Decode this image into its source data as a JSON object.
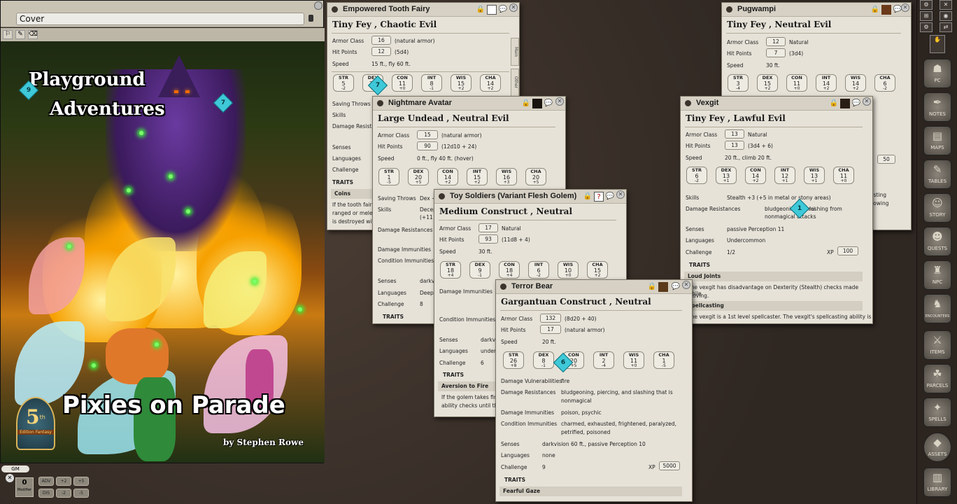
{
  "cover": {
    "title": "Cover",
    "book_title_line1": "Playground",
    "book_title_line2": "Adventures",
    "main_title": "Pixies on Parade",
    "author": "by Stephen Rowe",
    "edition_badge_number": "5",
    "edition_badge_suffix": "th",
    "edition_badge_text": "Edition Fantasy",
    "dice": [
      "9",
      "7"
    ]
  },
  "toolbar_icons": [
    "gear-icon",
    "dice-icon",
    "measure-icon",
    "eye-icon",
    "arrows-icon"
  ],
  "sidebar": [
    {
      "label": "PC",
      "icon": "person-icon"
    },
    {
      "label": "NOTES",
      "icon": "quill-icon"
    },
    {
      "label": "MAPS",
      "icon": "map-icon"
    },
    {
      "label": "TABLES",
      "icon": "table-icon"
    },
    {
      "label": "STORY",
      "icon": "mask-icon"
    },
    {
      "label": "QUESTS",
      "icon": "mask-icon"
    },
    {
      "label": "NPC",
      "icon": "helmet-icon"
    },
    {
      "label": "ENCOUNTERS",
      "icon": "helmet-icon"
    },
    {
      "label": "ITEMS",
      "icon": "sword-icon"
    },
    {
      "label": "PARCELS",
      "icon": "bag-icon"
    },
    {
      "label": "SPELLS",
      "icon": "book-icon"
    },
    {
      "label": "ASSETS",
      "icon": "gem-icon"
    },
    {
      "label": "LIBRARY",
      "icon": "books-icon"
    }
  ],
  "hotbar": {
    "gm_label": "GM",
    "modifier_value": "0",
    "modifier_label": "Modifier",
    "keys": [
      "ADV",
      "+2",
      "+5",
      "DIS",
      "-2",
      "-5"
    ]
  },
  "sheets": {
    "fairy": {
      "name": "Empowered Tooth Fairy",
      "type": "Tiny Fey , Chaotic Evil",
      "ac_label": "Armor Class",
      "ac": "16",
      "ac_note": "(natural armor)",
      "hp_label": "Hit Points",
      "hp": "12",
      "hp_note": "(5d4)",
      "speed_label": "Speed",
      "speed": "15 ft., fly 60 ft.",
      "stats": [
        [
          "STR",
          "5",
          "-2"
        ],
        [
          "DEX",
          "22",
          "+6"
        ],
        [
          "CON",
          "11",
          "+0"
        ],
        [
          "INT",
          "8",
          "-1"
        ],
        [
          "WIS",
          "15",
          "+2"
        ],
        [
          "CHA",
          "14",
          "+2"
        ]
      ],
      "saving_label": "Saving Throws",
      "skills_label": "Skills",
      "dmgres_label": "Damage Resistance",
      "senses_label": "Senses",
      "lang_label": "Languages",
      "challenge_label": "Challenge",
      "traits": "TRAITS",
      "trait1": "Coins",
      "trait1_text_a": "If the tooth fairy",
      "trait1_text_b": "ranged or melee",
      "trait1_text_c": "is destroyed with",
      "side_tab": "Main",
      "side_tab2": "Other"
    },
    "pugwampi": {
      "name": "Pugwampi",
      "type": "Tiny Fey , Neutral Evil",
      "ac_label": "Armor Class",
      "ac": "12",
      "ac_note": "Natural",
      "hp_label": "Hit Points",
      "hp": "7",
      "hp_note": "(3d4)",
      "speed_label": "Speed",
      "speed": "30 ft.",
      "stats": [
        [
          "STR",
          "3",
          "-4"
        ],
        [
          "DEX",
          "15",
          "+2"
        ],
        [
          "CON",
          "11",
          "+0"
        ],
        [
          "INT",
          "14",
          "+2"
        ],
        [
          "WIS",
          "14",
          "+2"
        ],
        [
          "CHA",
          "6",
          "-2"
        ]
      ],
      "xp_label": "XP",
      "xp": "50",
      "text_a": "asting",
      "text_b": "llowing"
    },
    "nightmare": {
      "name": "Nightmare Avatar",
      "type": "Large Undead , Neutral Evil",
      "ac_label": "Armor Class",
      "ac": "15",
      "ac_note": "(natural armor)",
      "hp_label": "Hit Points",
      "hp": "90",
      "hp_note": "(12d10 + 24)",
      "speed_label": "Speed",
      "speed": "0 ft., fly 40 ft. (hover)",
      "stats": [
        [
          "STR",
          "1",
          "-5"
        ],
        [
          "DEX",
          "20",
          "+5"
        ],
        [
          "CON",
          "14",
          "+2"
        ],
        [
          "INT",
          "15",
          "+2"
        ],
        [
          "WIS",
          "16",
          "+3"
        ],
        [
          "CHA",
          "20",
          "+5"
        ]
      ],
      "saving_label": "Saving Throws",
      "saving": "Dex +9",
      "skills_label": "Skills",
      "skills_a": "Decep",
      "skills_b": "(+11 in",
      "dmgres_label": "Damage Resistances",
      "dmgimm_label": "Damage Immunities",
      "condimm_label": "Condition Immunities",
      "senses_label": "Senses",
      "senses": "darkvis",
      "lang_label": "Languages",
      "lang": "Deep S",
      "challenge_label": "Challenge",
      "challenge": "8",
      "traits": "TRAITS"
    },
    "vexgit": {
      "name": "Vexgit",
      "type": "Tiny Fey , Lawful Evil",
      "ac_label": "Armor Class",
      "ac": "13",
      "ac_note": "Natural",
      "hp_label": "Hit Points",
      "hp": "13",
      "hp_note": "(3d4 + 6)",
      "speed_label": "Speed",
      "speed": "20 ft., climb 20 ft.",
      "stats": [
        [
          "STR",
          "6",
          "-2"
        ],
        [
          "DEX",
          "13",
          "+1"
        ],
        [
          "CON",
          "14",
          "+2"
        ],
        [
          "INT",
          "12",
          "+1"
        ],
        [
          "WIS",
          "13",
          "+1"
        ],
        [
          "CHA",
          "11",
          "+0"
        ]
      ],
      "skills_label": "Skills",
      "skills": "Stealth +3 (+5 in metal or stony areas)",
      "dmgres_label": "Damage Resistances",
      "dmgres_a": "bludgeoning, pierci",
      "dmgres_b": "lashing from",
      "dmgres_c": "nonmagical attacks",
      "senses_label": "Senses",
      "senses": "passive Perception 11",
      "lang_label": "Languages",
      "lang": "Undercommon",
      "challenge_label": "Challenge",
      "challenge": "1/2",
      "xp_label": "XP",
      "xp": "100",
      "traits": "TRAITS",
      "trait1": "Loud Joints",
      "trait1_text_a": "The vexgit has disadvantage on Dexterity (Stealth) checks made while",
      "trait1_text_b": "moving.",
      "trait2": "Spellcasting",
      "trait2_text": "The vexgit is a 1st level spellcaster. The vexgit's spellcasting ability is",
      "die": "1"
    },
    "soldiers": {
      "name": "Toy Soldiers (Variant Flesh Golem)",
      "type": "Medium Construct , Neutral",
      "ac_label": "Armor Class",
      "ac": "17",
      "ac_note": "Natural",
      "hp_label": "Hit Points",
      "hp": "93",
      "hp_note": "(11d8 + 4)",
      "speed_label": "Speed",
      "speed": "30 ft.",
      "stats": [
        [
          "STR",
          "18",
          "+4"
        ],
        [
          "DEX",
          "9",
          "-1"
        ],
        [
          "CON",
          "18",
          "+4"
        ],
        [
          "INT",
          "6",
          "-2"
        ],
        [
          "WIS",
          "10",
          "+0"
        ],
        [
          "CHA",
          "15",
          "+2"
        ]
      ],
      "dmgimm_label": "Damage Immunities",
      "condimm_label": "Condition Immunities",
      "senses_label": "Senses",
      "senses": "darkvi",
      "lang_label": "Languages",
      "lang": "unders",
      "challenge_label": "Challenge",
      "challenge": "6",
      "traits": "TRAITS",
      "trait1": "Aversion to Fire",
      "trait1_text_a": "If the golem takes fire d",
      "trait1_text_b": "ability checks until the e"
    },
    "bear": {
      "name": "Terror Bear",
      "type": "Gargantuan Construct , Neutral",
      "ac_label": "Armor Class",
      "ac": "132",
      "ac_note": "(8d20 + 40)",
      "hp_label": "Hit Points",
      "hp": "17",
      "hp_note": "(natural armor)",
      "speed_label": "Speed",
      "speed": "20 ft.",
      "stats": [
        [
          "STR",
          "26",
          "+8"
        ],
        [
          "DEX",
          "8",
          "-1"
        ],
        [
          "CON",
          "20",
          "+5"
        ],
        [
          "INT",
          "2",
          "-4"
        ],
        [
          "WIS",
          "11",
          "+0"
        ],
        [
          "CHA",
          "1",
          "-5"
        ]
      ],
      "vuln_label": "Damage Vulnerabilities",
      "vuln": "fire",
      "dmgres_label": "Damage Resistances",
      "dmgres_a": "bludgeoning, piercing, and slashing that is",
      "dmgres_b": "nonmagical",
      "dmgimm_label": "Damage Immunities",
      "dmgimm": "poison, psychic",
      "condimm_label": "Condition Immunities",
      "condimm_a": "charmed, exhausted, frightened, paralyzed,",
      "condimm_b": "petrified, poisoned",
      "senses_label": "Senses",
      "senses": "darkvision 60 ft., passive Perception 10",
      "lang_label": "Languages",
      "lang": "none",
      "challenge_label": "Challenge",
      "challenge": "9",
      "xp_label": "XP",
      "xp": "5000",
      "traits": "TRAITS",
      "trait1": "Fearful Gaze",
      "die": "6"
    }
  }
}
